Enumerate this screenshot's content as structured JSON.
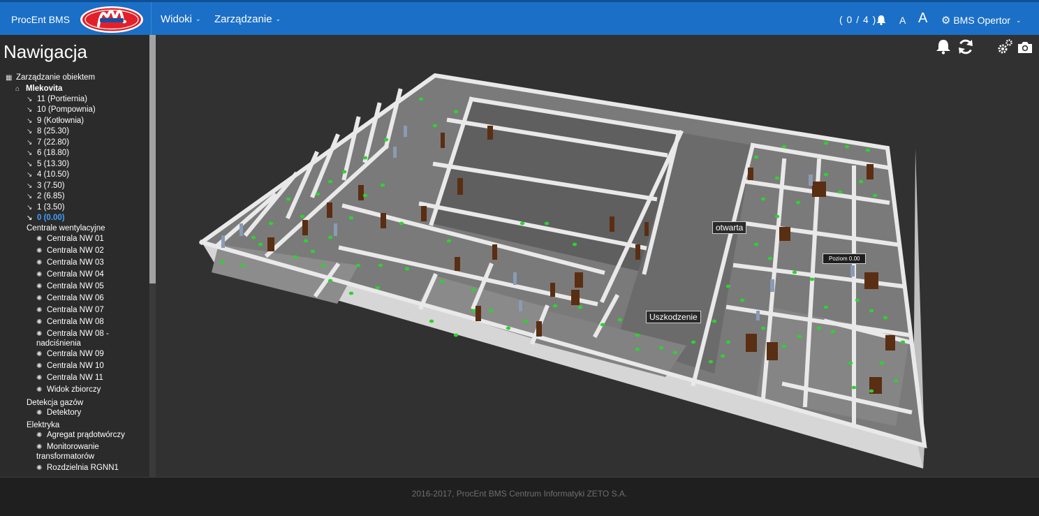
{
  "header": {
    "brand": "ProcEnt BMS",
    "logo_text": "MLEKOVITA",
    "menu_views": "Widoki",
    "menu_manage": "Zarządzanie",
    "alarm_count": "( 0 / 4 )",
    "font_small": "A",
    "font_large": "A",
    "user": "BMS Opertor"
  },
  "sidebar": {
    "title": "Nawigacja",
    "root": "Zarządzanie obiektem",
    "building": "Mlekovita",
    "levels": [
      "11 (Portiernia)",
      "10 (Pompownia)",
      "9 (Kotłownia)",
      "8 (25.30)",
      "7 (22.80)",
      "6 (18.80)",
      "5 (13.30)",
      "4 (10.50)",
      "3 (7.50)",
      "2 (6.85)",
      "1 (3.50)",
      "0 (0.00)"
    ],
    "active_level": "0 (0.00)",
    "group_vent": "Centrale wentylacyjne",
    "vent_items": [
      "Centrala NW 01",
      "Centrala NW 02",
      "Centrala NW 03",
      "Centrala NW 04",
      "Centrala NW 05",
      "Centrala NW 06",
      "Centrala NW 07",
      "Centrala NW 08",
      "Centrala NW 08 -",
      "nadciśnienia",
      "Centrala NW 09",
      "Centrala NW 10",
      "Centrala NW 11",
      "Widok zbiorczy"
    ],
    "group_gas": "Detekcja gazów",
    "gas_items": [
      "Detektory"
    ],
    "group_elec": "Elektryka",
    "elec_items": [
      "Agregat prądotwórczy",
      "Monitorowanie",
      "transformatorów",
      "Rozdzielnia RGNN1"
    ]
  },
  "viewer": {
    "tag_open": "otwarta",
    "tag_fault": "Uszkodzenie",
    "tag_level": "Poziom 0.00"
  },
  "footer": {
    "text": "2016-2017, ProcEnt BMS Centrum Informatyki ZETO S.A."
  },
  "icons": {
    "alarm": "bell-icon",
    "refresh": "refresh-icon",
    "settings": "gears-icon",
    "snapshot": "camera-icon",
    "user": "gear-icon"
  },
  "colors": {
    "header": "#1b6fc6",
    "active_level": "#3fa0ff",
    "sensor": "#2fd12f"
  }
}
